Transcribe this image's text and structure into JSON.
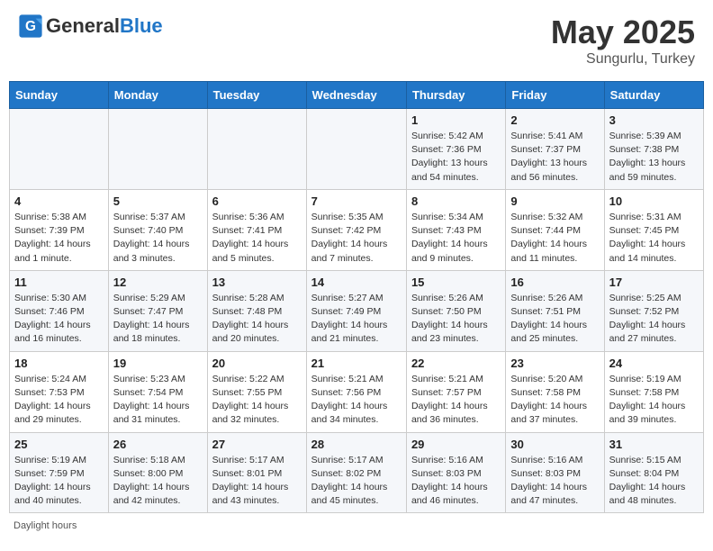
{
  "header": {
    "logo_general": "General",
    "logo_blue": "Blue",
    "month_year": "May 2025",
    "location": "Sungurlu, Turkey"
  },
  "footer": {
    "daylight_label": "Daylight hours"
  },
  "weekdays": [
    "Sunday",
    "Monday",
    "Tuesday",
    "Wednesday",
    "Thursday",
    "Friday",
    "Saturday"
  ],
  "weeks": [
    [
      {
        "day": "",
        "info": ""
      },
      {
        "day": "",
        "info": ""
      },
      {
        "day": "",
        "info": ""
      },
      {
        "day": "",
        "info": ""
      },
      {
        "day": "1",
        "info": "Sunrise: 5:42 AM\nSunset: 7:36 PM\nDaylight: 13 hours\nand 54 minutes."
      },
      {
        "day": "2",
        "info": "Sunrise: 5:41 AM\nSunset: 7:37 PM\nDaylight: 13 hours\nand 56 minutes."
      },
      {
        "day": "3",
        "info": "Sunrise: 5:39 AM\nSunset: 7:38 PM\nDaylight: 13 hours\nand 59 minutes."
      }
    ],
    [
      {
        "day": "4",
        "info": "Sunrise: 5:38 AM\nSunset: 7:39 PM\nDaylight: 14 hours\nand 1 minute."
      },
      {
        "day": "5",
        "info": "Sunrise: 5:37 AM\nSunset: 7:40 PM\nDaylight: 14 hours\nand 3 minutes."
      },
      {
        "day": "6",
        "info": "Sunrise: 5:36 AM\nSunset: 7:41 PM\nDaylight: 14 hours\nand 5 minutes."
      },
      {
        "day": "7",
        "info": "Sunrise: 5:35 AM\nSunset: 7:42 PM\nDaylight: 14 hours\nand 7 minutes."
      },
      {
        "day": "8",
        "info": "Sunrise: 5:34 AM\nSunset: 7:43 PM\nDaylight: 14 hours\nand 9 minutes."
      },
      {
        "day": "9",
        "info": "Sunrise: 5:32 AM\nSunset: 7:44 PM\nDaylight: 14 hours\nand 11 minutes."
      },
      {
        "day": "10",
        "info": "Sunrise: 5:31 AM\nSunset: 7:45 PM\nDaylight: 14 hours\nand 14 minutes."
      }
    ],
    [
      {
        "day": "11",
        "info": "Sunrise: 5:30 AM\nSunset: 7:46 PM\nDaylight: 14 hours\nand 16 minutes."
      },
      {
        "day": "12",
        "info": "Sunrise: 5:29 AM\nSunset: 7:47 PM\nDaylight: 14 hours\nand 18 minutes."
      },
      {
        "day": "13",
        "info": "Sunrise: 5:28 AM\nSunset: 7:48 PM\nDaylight: 14 hours\nand 20 minutes."
      },
      {
        "day": "14",
        "info": "Sunrise: 5:27 AM\nSunset: 7:49 PM\nDaylight: 14 hours\nand 21 minutes."
      },
      {
        "day": "15",
        "info": "Sunrise: 5:26 AM\nSunset: 7:50 PM\nDaylight: 14 hours\nand 23 minutes."
      },
      {
        "day": "16",
        "info": "Sunrise: 5:26 AM\nSunset: 7:51 PM\nDaylight: 14 hours\nand 25 minutes."
      },
      {
        "day": "17",
        "info": "Sunrise: 5:25 AM\nSunset: 7:52 PM\nDaylight: 14 hours\nand 27 minutes."
      }
    ],
    [
      {
        "day": "18",
        "info": "Sunrise: 5:24 AM\nSunset: 7:53 PM\nDaylight: 14 hours\nand 29 minutes."
      },
      {
        "day": "19",
        "info": "Sunrise: 5:23 AM\nSunset: 7:54 PM\nDaylight: 14 hours\nand 31 minutes."
      },
      {
        "day": "20",
        "info": "Sunrise: 5:22 AM\nSunset: 7:55 PM\nDaylight: 14 hours\nand 32 minutes."
      },
      {
        "day": "21",
        "info": "Sunrise: 5:21 AM\nSunset: 7:56 PM\nDaylight: 14 hours\nand 34 minutes."
      },
      {
        "day": "22",
        "info": "Sunrise: 5:21 AM\nSunset: 7:57 PM\nDaylight: 14 hours\nand 36 minutes."
      },
      {
        "day": "23",
        "info": "Sunrise: 5:20 AM\nSunset: 7:58 PM\nDaylight: 14 hours\nand 37 minutes."
      },
      {
        "day": "24",
        "info": "Sunrise: 5:19 AM\nSunset: 7:58 PM\nDaylight: 14 hours\nand 39 minutes."
      }
    ],
    [
      {
        "day": "25",
        "info": "Sunrise: 5:19 AM\nSunset: 7:59 PM\nDaylight: 14 hours\nand 40 minutes."
      },
      {
        "day": "26",
        "info": "Sunrise: 5:18 AM\nSunset: 8:00 PM\nDaylight: 14 hours\nand 42 minutes."
      },
      {
        "day": "27",
        "info": "Sunrise: 5:17 AM\nSunset: 8:01 PM\nDaylight: 14 hours\nand 43 minutes."
      },
      {
        "day": "28",
        "info": "Sunrise: 5:17 AM\nSunset: 8:02 PM\nDaylight: 14 hours\nand 45 minutes."
      },
      {
        "day": "29",
        "info": "Sunrise: 5:16 AM\nSunset: 8:03 PM\nDaylight: 14 hours\nand 46 minutes."
      },
      {
        "day": "30",
        "info": "Sunrise: 5:16 AM\nSunset: 8:03 PM\nDaylight: 14 hours\nand 47 minutes."
      },
      {
        "day": "31",
        "info": "Sunrise: 5:15 AM\nSunset: 8:04 PM\nDaylight: 14 hours\nand 48 minutes."
      }
    ]
  ]
}
